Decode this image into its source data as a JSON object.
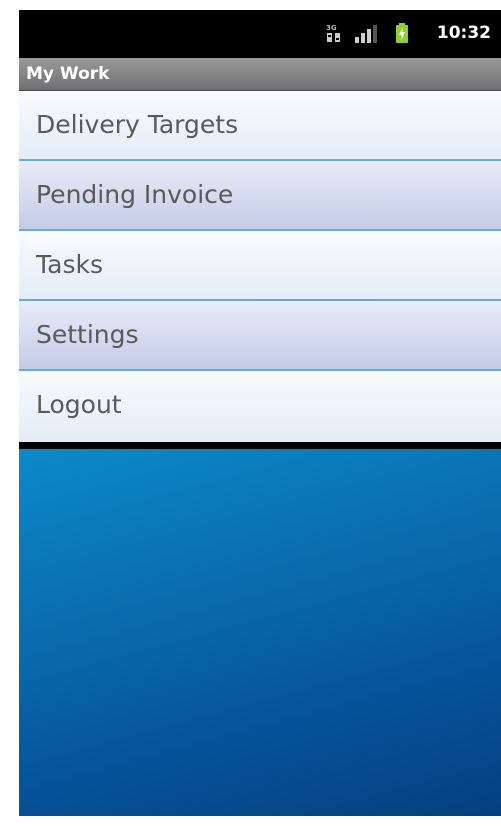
{
  "status_bar": {
    "time": "10:32",
    "icons": [
      "data-transfer-icon",
      "signal-strength-icon",
      "battery-charging-icon"
    ]
  },
  "app": {
    "title": "My Work"
  },
  "menu": {
    "items": [
      {
        "label": "Delivery Targets"
      },
      {
        "label": "Pending Invoice"
      },
      {
        "label": "Tasks"
      },
      {
        "label": "Settings"
      },
      {
        "label": "Logout"
      }
    ]
  },
  "colors": {
    "divider": "#5fb0d2",
    "background_top": "#0b8ac9",
    "background_bottom": "#04407f",
    "title_bar": "#7f7f7f"
  }
}
